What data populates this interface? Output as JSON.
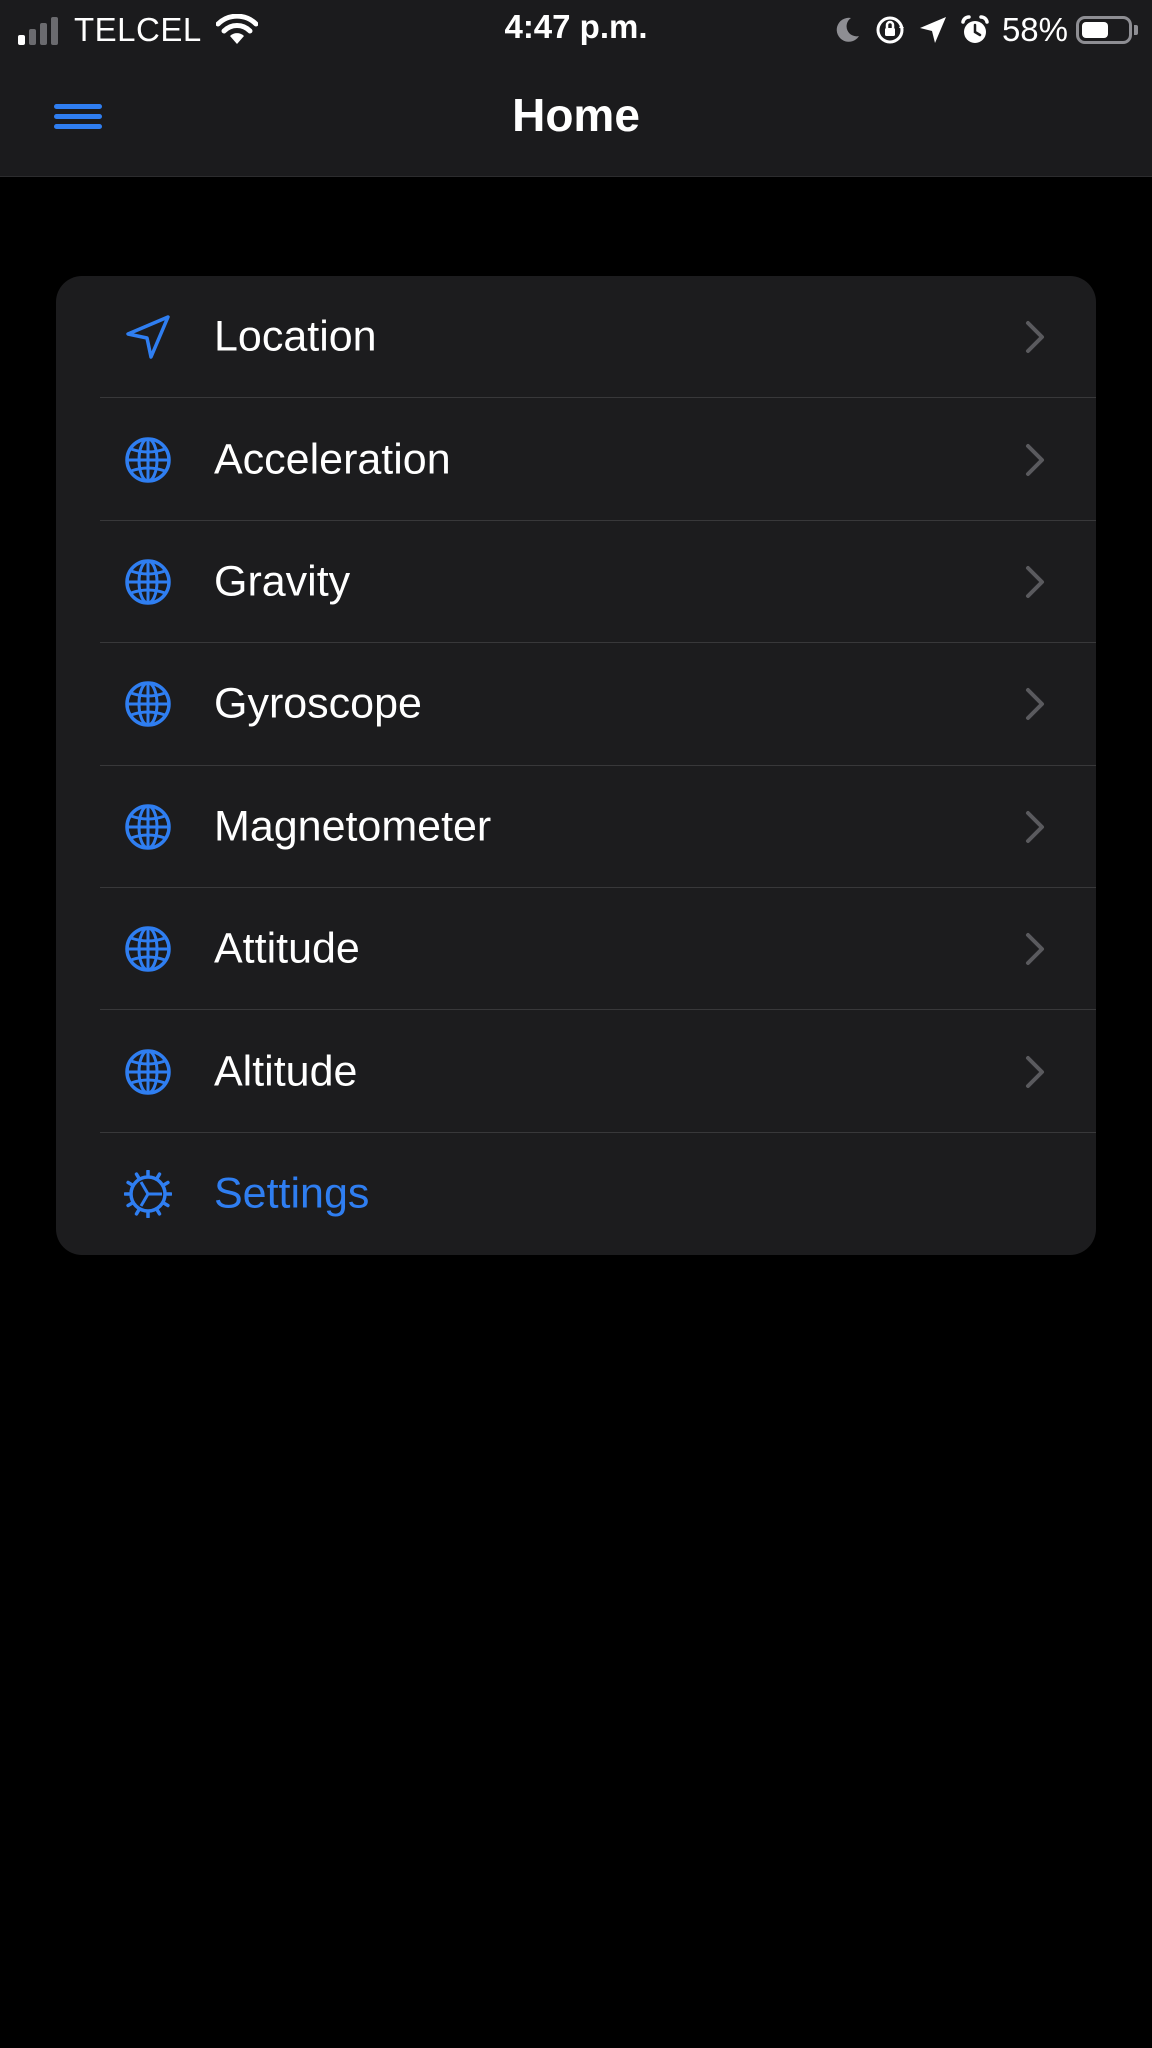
{
  "status_bar": {
    "carrier": "TELCEL",
    "time": "4:47 p.m.",
    "battery_percent": "58%",
    "battery_level": 0.58,
    "signal_bars_active": 1,
    "signal_bars_total": 4
  },
  "nav": {
    "title": "Home",
    "menu_icon": "hamburger-menu-icon"
  },
  "colors": {
    "accent": "#2f7ef1",
    "background": "#000000",
    "card": "#1c1c1e",
    "chevron": "#5a5a5e"
  },
  "menu": {
    "items": [
      {
        "label": "Location",
        "icon": "location-arrow-icon",
        "chevron": true
      },
      {
        "label": "Acceleration",
        "icon": "globe-icon",
        "chevron": true
      },
      {
        "label": "Gravity",
        "icon": "globe-icon",
        "chevron": true
      },
      {
        "label": "Gyroscope",
        "icon": "globe-icon",
        "chevron": true
      },
      {
        "label": "Magnetometer",
        "icon": "globe-icon",
        "chevron": true
      },
      {
        "label": "Attitude",
        "icon": "globe-icon",
        "chevron": true
      },
      {
        "label": "Altitude",
        "icon": "globe-icon",
        "chevron": true
      },
      {
        "label": "Settings",
        "icon": "settings-gear-icon",
        "chevron": false,
        "accent": true
      }
    ]
  }
}
